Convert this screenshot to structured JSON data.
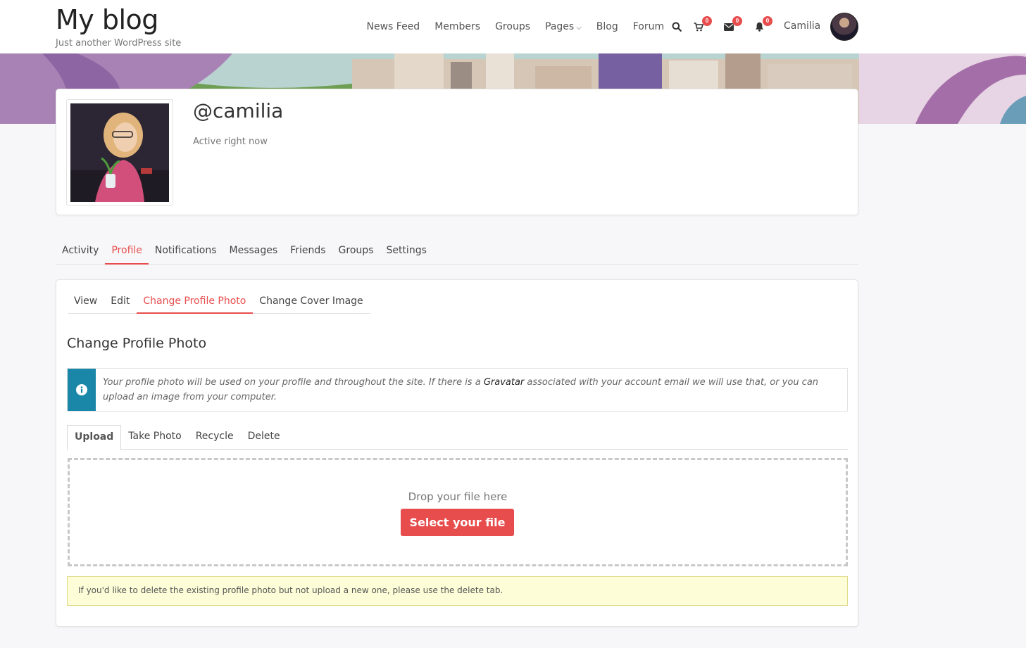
{
  "site": {
    "title": "My blog",
    "tagline": "Just another WordPress site"
  },
  "nav": {
    "items": [
      "News Feed",
      "Members",
      "Groups",
      "Pages",
      "Blog",
      "Forum"
    ],
    "cart_count": "0",
    "messages_count": "0",
    "notifications_count": "0",
    "user_name": "Camilia"
  },
  "profile": {
    "username": "@camilia",
    "status": "Active right now"
  },
  "main_tabs": [
    "Activity",
    "Profile",
    "Notifications",
    "Messages",
    "Friends",
    "Groups",
    "Settings"
  ],
  "sub_tabs": [
    "View",
    "Edit",
    "Change Profile Photo",
    "Change Cover Image"
  ],
  "content": {
    "title": "Change Profile Photo",
    "info_before": "Your profile photo will be used on your profile and throughout the site. If there is a ",
    "info_link": "Gravatar",
    "info_after": " associated with your account email we will use that, or you can upload an image from your computer.",
    "upload_tabs": [
      "Upload",
      "Take Photo",
      "Recycle",
      "Delete"
    ],
    "drop_text": "Drop your file here",
    "select_button": "Select your file",
    "notice": "If you'd like to delete the existing profile photo but not upload a new one, please use the delete tab."
  },
  "colors": {
    "accent": "#e84d4d",
    "info": "#1a87a8",
    "notice_bg": "#fdfdd7"
  },
  "icons": {
    "search": "search-icon",
    "cart": "cart-icon",
    "messages": "envelope-icon",
    "notifications": "bell-icon",
    "info": "info-icon",
    "pages_menu": "chevron-down-icon"
  }
}
